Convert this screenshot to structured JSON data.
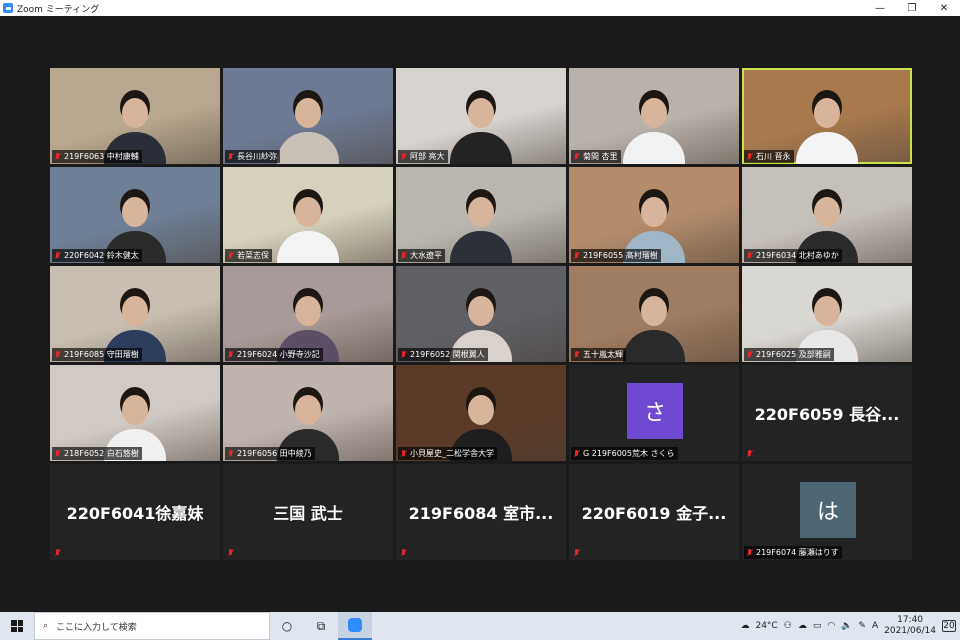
{
  "window": {
    "title": "Zoom ミーティング",
    "controls": [
      "—",
      "❐",
      "✕"
    ]
  },
  "tiles": [
    {
      "type": "video",
      "name": "219F6063 中村康輔",
      "bg": "#b9a890",
      "shirt": "#2a2e38"
    },
    {
      "type": "video",
      "name": "長谷川紗弥",
      "bg": "#6e7a93",
      "shirt": "#c9c1b8"
    },
    {
      "type": "video",
      "name": "阿部 亮大",
      "bg": "#d7d3cf",
      "shirt": "#232323"
    },
    {
      "type": "video",
      "name": "菊間 杏里",
      "bg": "#b9b2aa",
      "shirt": "#f1f1f1"
    },
    {
      "type": "video",
      "name": "石川 晋永",
      "bg": "#a7794c",
      "shirt": "#f4f4f4",
      "active": true
    },
    {
      "type": "video",
      "name": "220F6042 鈴木健太",
      "bg": "#6f7f95",
      "shirt": "#2b2b2b"
    },
    {
      "type": "video",
      "name": "若菜志保",
      "bg": "#d6d1bd",
      "shirt": "#f3f3f3"
    },
    {
      "type": "video",
      "name": "大水遼平",
      "bg": "#bab7b0",
      "shirt": "#2c3038"
    },
    {
      "type": "video",
      "name": "219F6055 髙村瑠樹",
      "bg": "#b58c6a",
      "shirt": "#9fb6c7"
    },
    {
      "type": "video",
      "name": "219F6034 北村あゆか",
      "bg": "#c6c0ba",
      "shirt": "#2b2b2b"
    },
    {
      "type": "video",
      "name": "219F6085 守田瑠樹",
      "bg": "#c8bfb2",
      "shirt": "#2e3d5b"
    },
    {
      "type": "video",
      "name": "219F6024 小野寺沙記",
      "bg": "#a79a98",
      "shirt": "#5b4f66"
    },
    {
      "type": "video",
      "name": "219F6052 関根翼人",
      "bg": "#5f6066",
      "shirt": "#d9d2cc"
    },
    {
      "type": "video",
      "name": "五十嵐太輝",
      "bg": "#a07d61",
      "shirt": "#2a2a2a"
    },
    {
      "type": "video",
      "name": "219F6025 及部雅嗣",
      "bg": "#d9d7d2",
      "shirt": "#e8e8e8"
    },
    {
      "type": "video",
      "name": "218F6052 白石悠樹",
      "bg": "#d1cac4",
      "shirt": "#f0f0f0"
    },
    {
      "type": "video",
      "name": "219F6056 田中綾乃",
      "bg": "#bfb3ad",
      "shirt": "#2a2a2a"
    },
    {
      "type": "video",
      "name": "小貝屋史_二松学舎大学",
      "bg": "#5b3a27",
      "shirt": "#1e1e1e"
    },
    {
      "type": "avatar",
      "name": "G 219F6005荒木 さくら",
      "letter": "さ",
      "color": "#6f4ad0"
    },
    {
      "type": "text",
      "name": "",
      "big": "220F6059 長谷..."
    },
    {
      "type": "text",
      "name": "",
      "big": "220F6041徐嘉妹"
    },
    {
      "type": "text",
      "name": "",
      "big": "三国 武士"
    },
    {
      "type": "text",
      "name": "",
      "big": "219F6084 室市..."
    },
    {
      "type": "text",
      "name": "",
      "big": "220F6019 金子..."
    },
    {
      "type": "avatar",
      "name": "219F6074 藤瀬はりす",
      "letter": "は",
      "color": "#4e6672"
    }
  ],
  "taskbar": {
    "search_placeholder": "ここに入力して検索",
    "weather": "24°C",
    "ime": "A",
    "time": "17:40",
    "date": "2021/06/14",
    "notifications": "20"
  }
}
